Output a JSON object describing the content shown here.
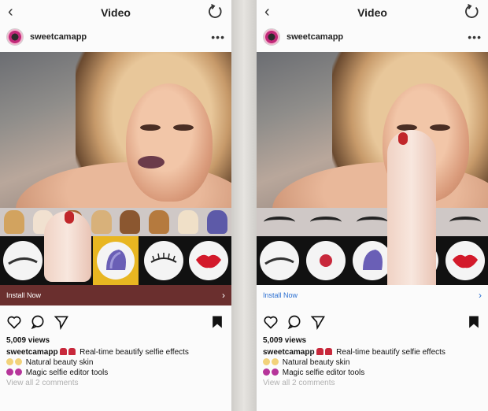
{
  "left": {
    "nav": {
      "title": "Video"
    },
    "account": {
      "name": "sweetcamapp"
    },
    "cta": {
      "label": "Install Now"
    },
    "views": "5,009 views",
    "caption": {
      "user": "sweetcamapp",
      "line1": "Real-time beautify selfie effects",
      "line2": "Natural beauty skin",
      "line3": "Magic selfie editor tools"
    },
    "comments": "View all 2 comments"
  },
  "right": {
    "nav": {
      "title": "Video"
    },
    "account": {
      "name": "sweetcamapp"
    },
    "cta": {
      "label": "Install Now"
    },
    "views": "5,009 views",
    "caption": {
      "user": "sweetcamapp",
      "line1": "Real-time beautify selfie effects",
      "line2": "Natural beauty skin",
      "line3": "Magic selfie editor tools"
    },
    "comments": "View all 2 comments"
  },
  "icons": [
    "back-icon",
    "refresh-icon",
    "more-icon",
    "heart-icon",
    "comment-icon",
    "share-icon",
    "bookmark-icon",
    "eyebrow-icon",
    "lips-icon",
    "lash-icon",
    "hair-icon"
  ],
  "colors": {
    "cta_left_bg": "#6a2f2e",
    "cta_right_text": "#2b6fd1",
    "toolbar_bg": "#111111",
    "selected": "#e8b621"
  }
}
